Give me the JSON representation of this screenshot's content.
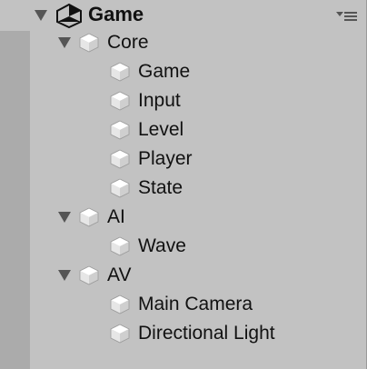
{
  "hierarchy": {
    "scene": {
      "name": "Game",
      "icon": "unity-logo-icon",
      "options_icon": "context-menu-icon"
    },
    "nodes": [
      {
        "label": "Core",
        "level": 1,
        "expanded": true
      },
      {
        "label": "Game",
        "level": 2
      },
      {
        "label": "Input",
        "level": 2
      },
      {
        "label": "Level",
        "level": 2
      },
      {
        "label": "Player",
        "level": 2
      },
      {
        "label": "State",
        "level": 2
      },
      {
        "label": "AI",
        "level": 1,
        "expanded": true
      },
      {
        "label": "Wave",
        "level": 2
      },
      {
        "label": "AV",
        "level": 1,
        "expanded": true
      },
      {
        "label": "Main Camera",
        "level": 2
      },
      {
        "label": "Directional Light",
        "level": 2
      }
    ]
  }
}
